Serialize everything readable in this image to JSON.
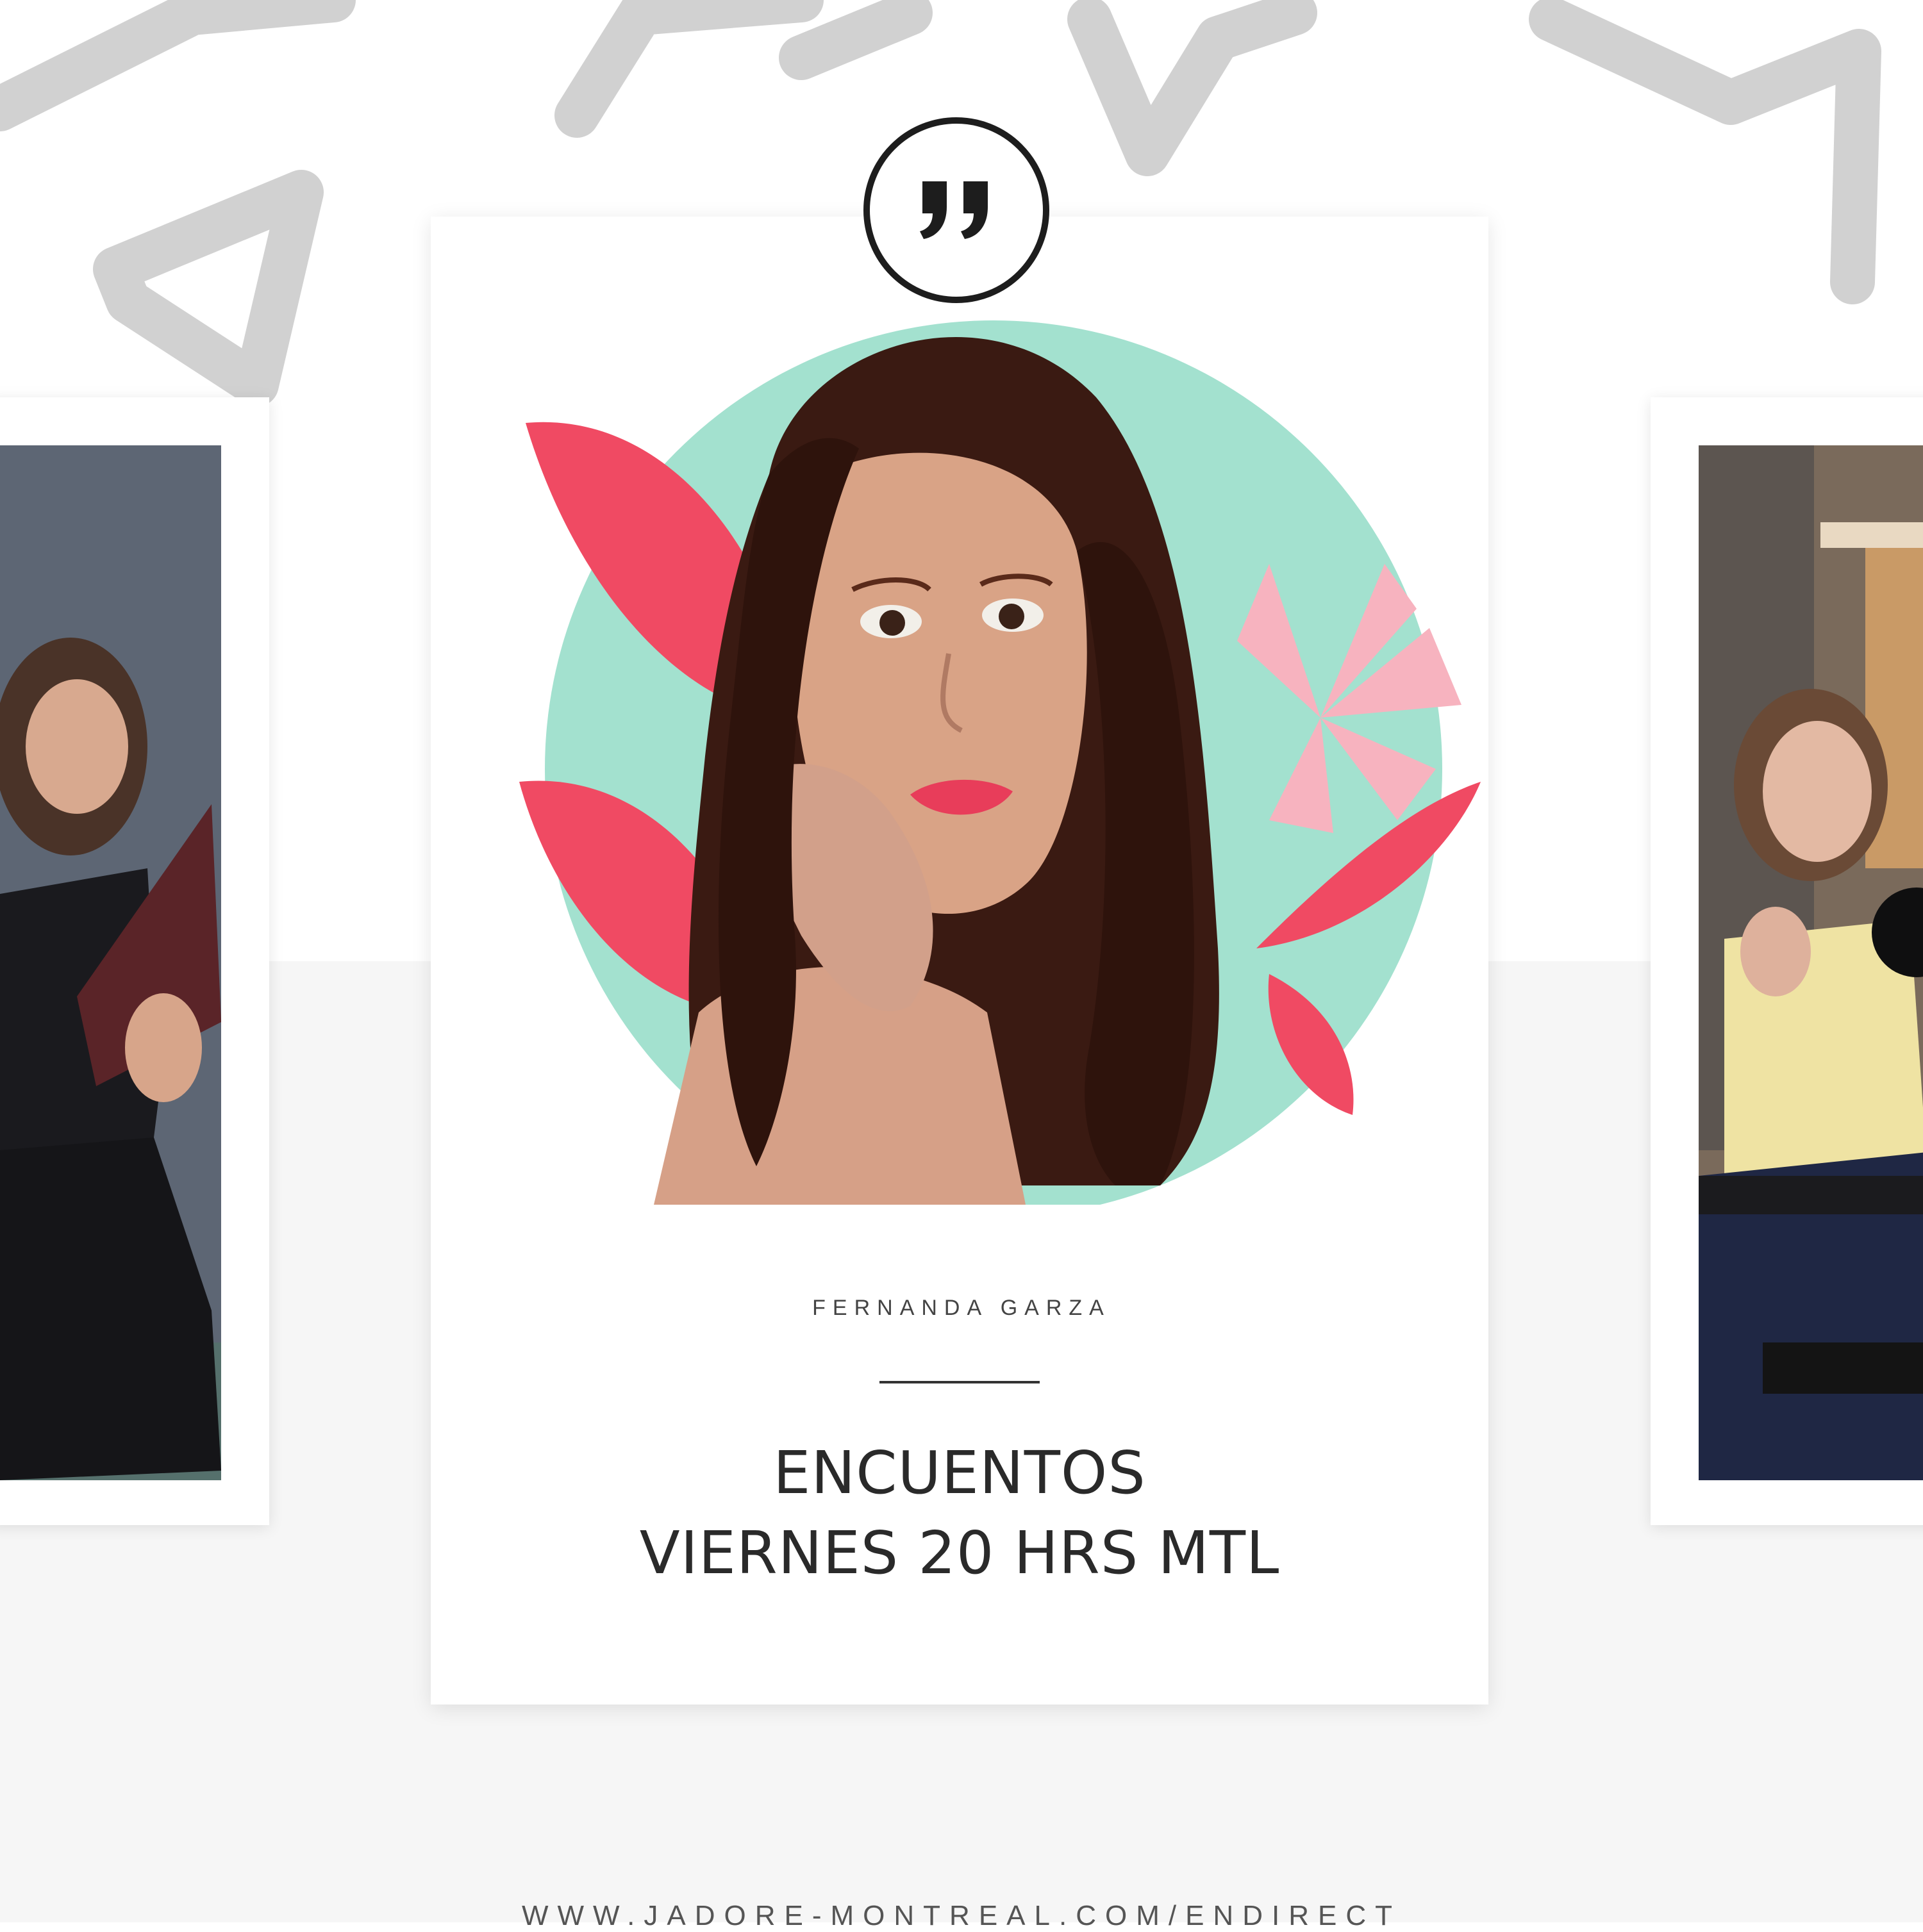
{
  "quote_icon": "quotation-mark-icon",
  "author": "FERNANDA GARZA",
  "title_lines": [
    "ENCUENTOS",
    "VIERNES 20 HRS MTL"
  ],
  "footer_url": "WWW.JADORE-MONTREAL.COM/ENDIRECT",
  "colors": {
    "accent_circle": "#a3e1cf",
    "leaf_red": "#f04a63",
    "leaf_pink": "#f7b3bf",
    "text_dark": "#2a2a2a"
  },
  "images": {
    "left_photo": "woman-reading-book-photo",
    "center_portrait": "painted-portrait-illustration",
    "right_photo": "woman-singing-at-keyboard-photo"
  }
}
